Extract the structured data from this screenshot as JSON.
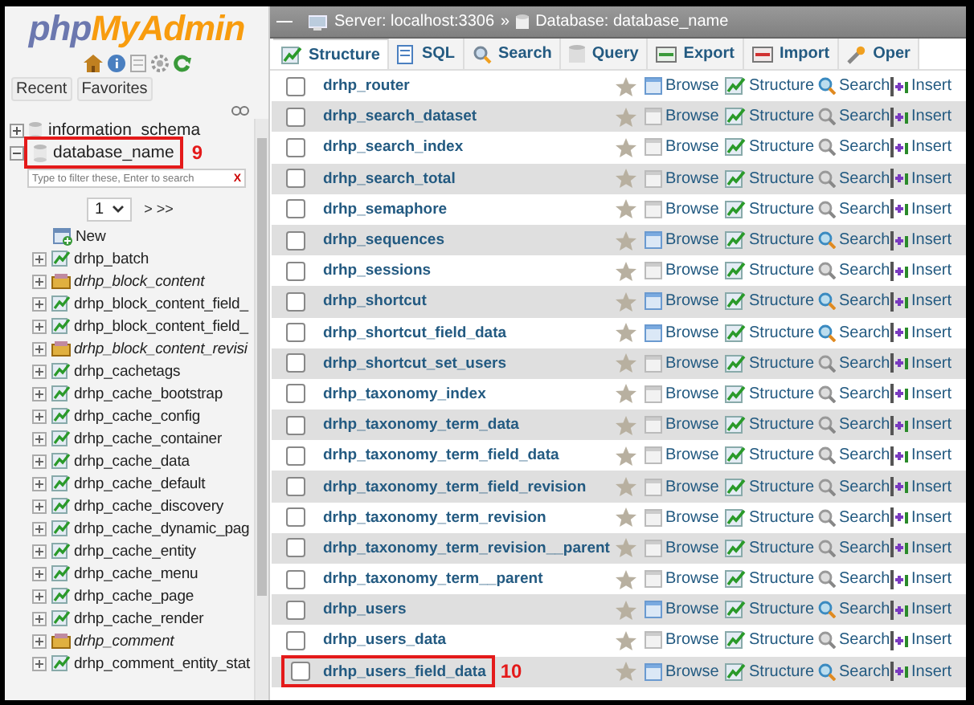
{
  "logo": {
    "first": "php",
    "second": "MyAdmin"
  },
  "nav_buttons": [
    "Recent",
    "Favorites"
  ],
  "databases": [
    {
      "name": "information_schema",
      "expanded": false
    },
    {
      "name": "database_name",
      "expanded": true,
      "callout": "9",
      "filter_placeholder": "Type to filter these, Enter to search",
      "filter_clear": "X",
      "page": "1",
      "pager": "> >>",
      "new_label": "New",
      "children": [
        {
          "name": "drhp_batch",
          "kind": "table"
        },
        {
          "name": "drhp_block_content",
          "kind": "view"
        },
        {
          "name": "drhp_block_content_field_",
          "kind": "table"
        },
        {
          "name": "drhp_block_content_field_",
          "kind": "table"
        },
        {
          "name": "drhp_block_content_revisi",
          "kind": "view"
        },
        {
          "name": "drhp_cachetags",
          "kind": "table"
        },
        {
          "name": "drhp_cache_bootstrap",
          "kind": "table"
        },
        {
          "name": "drhp_cache_config",
          "kind": "table"
        },
        {
          "name": "drhp_cache_container",
          "kind": "table"
        },
        {
          "name": "drhp_cache_data",
          "kind": "table"
        },
        {
          "name": "drhp_cache_default",
          "kind": "table"
        },
        {
          "name": "drhp_cache_discovery",
          "kind": "table"
        },
        {
          "name": "drhp_cache_dynamic_pag",
          "kind": "table"
        },
        {
          "name": "drhp_cache_entity",
          "kind": "table"
        },
        {
          "name": "drhp_cache_menu",
          "kind": "table"
        },
        {
          "name": "drhp_cache_page",
          "kind": "table"
        },
        {
          "name": "drhp_cache_render",
          "kind": "table"
        },
        {
          "name": "drhp_comment",
          "kind": "view"
        },
        {
          "name": "drhp_comment_entity_stat",
          "kind": "table"
        }
      ]
    }
  ],
  "breadcrumb": {
    "server": "Server: localhost:3306",
    "separator": "»",
    "database": "Database: database_name"
  },
  "tabs": [
    {
      "label": "Structure",
      "selected": true
    },
    {
      "label": "SQL",
      "selected": false
    },
    {
      "label": "Search",
      "selected": false
    },
    {
      "label": "Query",
      "selected": false
    },
    {
      "label": "Export",
      "selected": false
    },
    {
      "label": "Import",
      "selected": false
    },
    {
      "label": "Oper",
      "selected": false
    }
  ],
  "tables": [
    {
      "name": "drhp_router",
      "checked": false,
      "empty": false,
      "actions": [
        "Browse",
        "Structure",
        "Search",
        "Insert"
      ]
    },
    {
      "name": "drhp_search_dataset",
      "checked": false,
      "empty": true,
      "actions": [
        "Browse",
        "Structure",
        "Search",
        "Insert"
      ]
    },
    {
      "name": "drhp_search_index",
      "checked": false,
      "empty": true,
      "actions": [
        "Browse",
        "Structure",
        "Search",
        "Insert"
      ]
    },
    {
      "name": "drhp_search_total",
      "checked": false,
      "empty": true,
      "actions": [
        "Browse",
        "Structure",
        "Search",
        "Insert"
      ]
    },
    {
      "name": "drhp_semaphore",
      "checked": false,
      "empty": true,
      "actions": [
        "Browse",
        "Structure",
        "Search",
        "Insert"
      ]
    },
    {
      "name": "drhp_sequences",
      "checked": false,
      "empty": false,
      "actions": [
        "Browse",
        "Structure",
        "Search",
        "Insert"
      ]
    },
    {
      "name": "drhp_sessions",
      "checked": false,
      "empty": true,
      "actions": [
        "Browse",
        "Structure",
        "Search",
        "Insert"
      ]
    },
    {
      "name": "drhp_shortcut",
      "checked": false,
      "empty": false,
      "actions": [
        "Browse",
        "Structure",
        "Search",
        "Insert"
      ]
    },
    {
      "name": "drhp_shortcut_field_data",
      "checked": false,
      "empty": false,
      "actions": [
        "Browse",
        "Structure",
        "Search",
        "Insert"
      ]
    },
    {
      "name": "drhp_shortcut_set_users",
      "checked": false,
      "empty": true,
      "actions": [
        "Browse",
        "Structure",
        "Search",
        "Insert"
      ]
    },
    {
      "name": "drhp_taxonomy_index",
      "checked": false,
      "empty": true,
      "actions": [
        "Browse",
        "Structure",
        "Search",
        "Insert"
      ]
    },
    {
      "name": "drhp_taxonomy_term_data",
      "checked": false,
      "empty": true,
      "actions": [
        "Browse",
        "Structure",
        "Search",
        "Insert"
      ]
    },
    {
      "name": "drhp_taxonomy_term_field_data",
      "checked": false,
      "empty": true,
      "actions": [
        "Browse",
        "Structure",
        "Search",
        "Insert"
      ]
    },
    {
      "name": "drhp_taxonomy_term_field_revision",
      "checked": false,
      "empty": true,
      "actions": [
        "Browse",
        "Structure",
        "Search",
        "Insert"
      ]
    },
    {
      "name": "drhp_taxonomy_term_revision",
      "checked": false,
      "empty": true,
      "actions": [
        "Browse",
        "Structure",
        "Search",
        "Insert"
      ]
    },
    {
      "name": "drhp_taxonomy_term_revision__parent",
      "checked": false,
      "empty": true,
      "actions": [
        "Browse",
        "Structure",
        "Search",
        "Insert"
      ]
    },
    {
      "name": "drhp_taxonomy_term__parent",
      "checked": false,
      "empty": true,
      "actions": [
        "Browse",
        "Structure",
        "Search",
        "Insert"
      ]
    },
    {
      "name": "drhp_users",
      "checked": false,
      "empty": false,
      "actions": [
        "Browse",
        "Structure",
        "Search",
        "Insert"
      ]
    },
    {
      "name": "drhp_users_data",
      "checked": false,
      "empty": true,
      "actions": [
        "Browse",
        "Structure",
        "Search",
        "Insert"
      ]
    },
    {
      "name": "drhp_users_field_data",
      "checked": false,
      "empty": false,
      "callout": "10",
      "actions": [
        "Browse",
        "Structure",
        "Search",
        "Insert"
      ]
    }
  ]
}
